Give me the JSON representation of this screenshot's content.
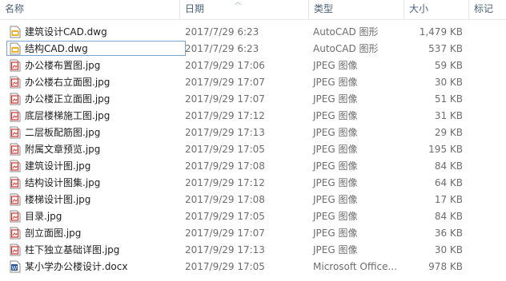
{
  "header": {
    "name": "名称",
    "date": "日期",
    "type": "类型",
    "size": "大小",
    "tags": "标记"
  },
  "files": [
    {
      "name": "建筑设计CAD.dwg",
      "date": "2017/7/29 6:23",
      "type": "AutoCAD 图形",
      "size": "1,479 KB",
      "icon": "dwg-file-icon"
    },
    {
      "name": "结构CAD.dwg",
      "date": "2017/7/29 6:23",
      "type": "AutoCAD 图形",
      "size": "537 KB",
      "icon": "dwg-file-icon"
    },
    {
      "name": "办公楼布置图.jpg",
      "date": "2017/9/29 17:06",
      "type": "JPEG 图像",
      "size": "59 KB",
      "icon": "jpeg-file-icon"
    },
    {
      "name": "办公楼右立面图.jpg",
      "date": "2017/9/29 17:07",
      "type": "JPEG 图像",
      "size": "30 KB",
      "icon": "jpeg-file-icon"
    },
    {
      "name": "办公楼正立面图.jpg",
      "date": "2017/9/29 17:07",
      "type": "JPEG 图像",
      "size": "51 KB",
      "icon": "jpeg-file-icon"
    },
    {
      "name": "底层楼梯施工图.jpg",
      "date": "2017/9/29 17:12",
      "type": "JPEG 图像",
      "size": "31 KB",
      "icon": "jpeg-file-icon"
    },
    {
      "name": "二层板配筋图.jpg",
      "date": "2017/9/29 17:13",
      "type": "JPEG 图像",
      "size": "29 KB",
      "icon": "jpeg-file-icon"
    },
    {
      "name": "附属文章预览.jpg",
      "date": "2017/9/29 17:05",
      "type": "JPEG 图像",
      "size": "195 KB",
      "icon": "jpeg-file-icon"
    },
    {
      "name": "建筑设计图.jpg",
      "date": "2017/9/29 17:08",
      "type": "JPEG 图像",
      "size": "84 KB",
      "icon": "jpeg-file-icon"
    },
    {
      "name": "结构设计图集.jpg",
      "date": "2017/9/29 17:12",
      "type": "JPEG 图像",
      "size": "64 KB",
      "icon": "jpeg-file-icon"
    },
    {
      "name": "楼梯设计图.jpg",
      "date": "2017/9/29 17:08",
      "type": "JPEG 图像",
      "size": "17 KB",
      "icon": "jpeg-file-icon"
    },
    {
      "name": "目录.jpg",
      "date": "2017/9/29 17:05",
      "type": "JPEG 图像",
      "size": "84 KB",
      "icon": "jpeg-file-icon"
    },
    {
      "name": "剖立面图.jpg",
      "date": "2017/9/29 17:07",
      "type": "JPEG 图像",
      "size": "36 KB",
      "icon": "jpeg-file-icon"
    },
    {
      "name": "柱下独立基础详图.jpg",
      "date": "2017/9/29 17:13",
      "type": "JPEG 图像",
      "size": "30 KB",
      "icon": "jpeg-file-icon"
    },
    {
      "name": "某小学办公楼设计.docx",
      "date": "2017/9/29 17:05",
      "type": "Microsoft Office...",
      "size": "978 KB",
      "icon": "word-doc-icon"
    }
  ],
  "selected_index": 1,
  "colors": {
    "header_text": "#4c607a",
    "muted_text": "#6d6d6d",
    "selection_border": "#7da2ce",
    "jpeg_icon_red": "#d9302b",
    "dwg_icon_yellow": "#e8b022",
    "word_icon_blue": "#2b579a"
  }
}
